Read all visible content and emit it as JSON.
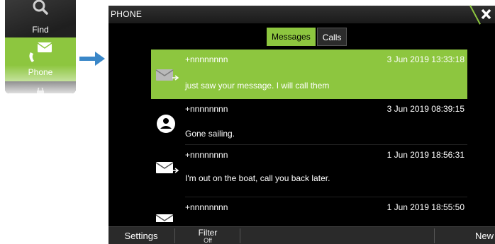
{
  "side_menu": {
    "items": [
      {
        "label": "Find",
        "icon": "search-icon"
      },
      {
        "label": "Phone",
        "icon": "phone-message-icon",
        "selected": true
      },
      {
        "label": "",
        "icon": "shopping-bag-icon"
      }
    ]
  },
  "window": {
    "title": "PHONE",
    "close_icon": "close-icon"
  },
  "tabs": [
    {
      "label": "Messages",
      "active": true
    },
    {
      "label": "Calls",
      "active": false
    }
  ],
  "messages": [
    {
      "sender": "+nnnnnnnn",
      "date": "3 Jun 2019 13:33:18",
      "text": "just saw your message. I will call them",
      "icon": "sent-envelope-icon",
      "selected": true
    },
    {
      "sender": "+nnnnnnnn",
      "date": "3 Jun 2019 08:39:15",
      "text": "Gone sailing.",
      "icon": "person-avatar-icon",
      "selected": false
    },
    {
      "sender": "+nnnnnnnn",
      "date": "1 Jun 2019 18:56:31",
      "text": "I'm out on the boat, call you back later.",
      "icon": "sent-envelope-icon",
      "selected": false
    },
    {
      "sender": "+nnnnnnnn",
      "date": "1 Jun 2019 18:55:50",
      "text": "",
      "icon": "sent-envelope-icon",
      "selected": false
    }
  ],
  "bottom_bar": {
    "settings": "Settings",
    "filter": "Filter",
    "filter_state": "Off",
    "new_message": "New message..."
  },
  "colors": {
    "accent": "#8dc63f",
    "background": "#000000",
    "arrow": "#3a87c8"
  }
}
